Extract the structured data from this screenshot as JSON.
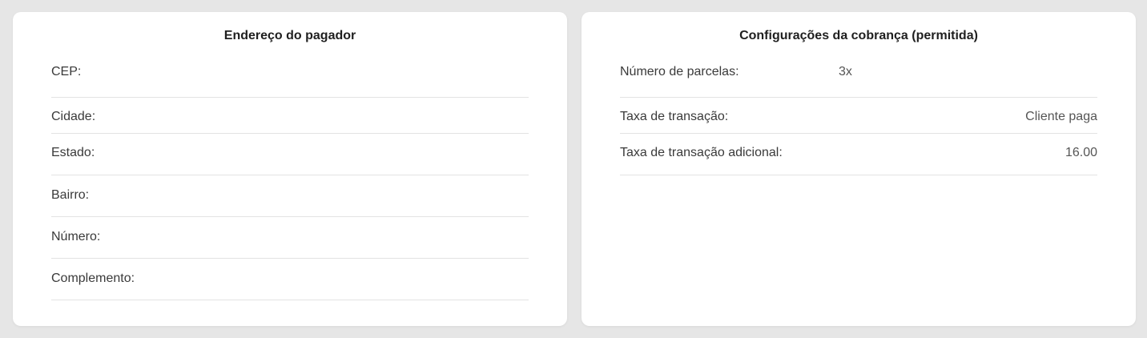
{
  "payer_address": {
    "title": "Endereço do pagador",
    "rows": [
      {
        "label": "CEP:",
        "value": ""
      },
      {
        "label": "Cidade:",
        "value": ""
      },
      {
        "label": "Estado:",
        "value": ""
      },
      {
        "label": "Bairro:",
        "value": ""
      },
      {
        "label": "Número:",
        "value": ""
      },
      {
        "label": "Complemento:",
        "value": ""
      }
    ]
  },
  "charge_settings": {
    "title": "Configurações da cobrança (permitida)",
    "rows": [
      {
        "label": "Número de parcelas:",
        "value": "3x"
      },
      {
        "label": "Taxa de transação:",
        "value": "Cliente paga"
      },
      {
        "label": "Taxa de transação adicional:",
        "value": "16.00"
      }
    ]
  }
}
